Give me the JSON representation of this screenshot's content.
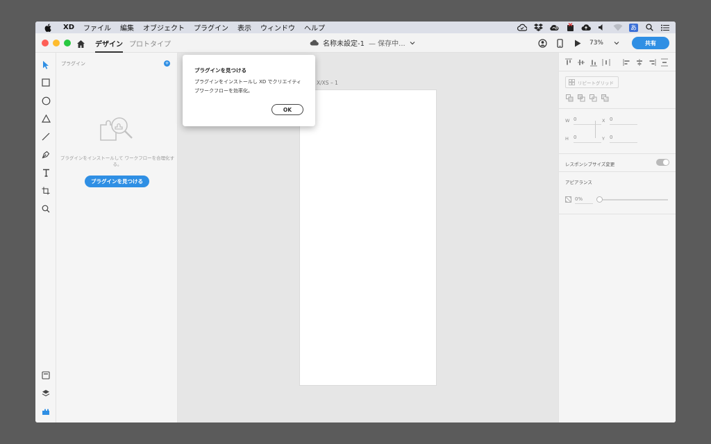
{
  "menubar": {
    "app_name": "XD",
    "items": [
      "ファイル",
      "編集",
      "オブジェクト",
      "プラグイン",
      "表示",
      "ウィンドウ",
      "ヘルプ"
    ],
    "input_method": "あ"
  },
  "toolbar": {
    "tab_design": "デザイン",
    "tab_prototype": "プロトタイプ",
    "doc_title": "名称未設定-1",
    "doc_status": "— 保存中...",
    "zoom": "73%",
    "share_label": "共有"
  },
  "plugins_panel": {
    "header": "プラグイン",
    "add_glyph": "+",
    "empty_text": "プラグインをインストールして ワークフローを合理化する。",
    "find_button": "プラグインを見つける"
  },
  "canvas": {
    "artboard_label": "e X/XS – 1"
  },
  "dialog": {
    "title": "プラグインを見つける",
    "body": "プラグインをインストールし XD でクリエイティブワークフローを効率化。",
    "ok_label": "OK"
  },
  "inspector": {
    "repeat_grid": "リピートグリッド",
    "w_label": "W",
    "w_value": "0",
    "x_label": "X",
    "x_value": "0",
    "h_label": "H",
    "h_value": "0",
    "y_label": "Y",
    "y_value": "0",
    "responsive_resize": "レスポンシブサイズ変更",
    "responsive_on": true,
    "appearance": "アピアランス",
    "opacity": "0%"
  },
  "colors": {
    "accent": "#2f8fe4",
    "close": "#fe5f57",
    "minimize": "#febc2e",
    "zoom": "#28c840",
    "canvas": "#e6e6e6",
    "menubar": "#dcdfe8"
  }
}
